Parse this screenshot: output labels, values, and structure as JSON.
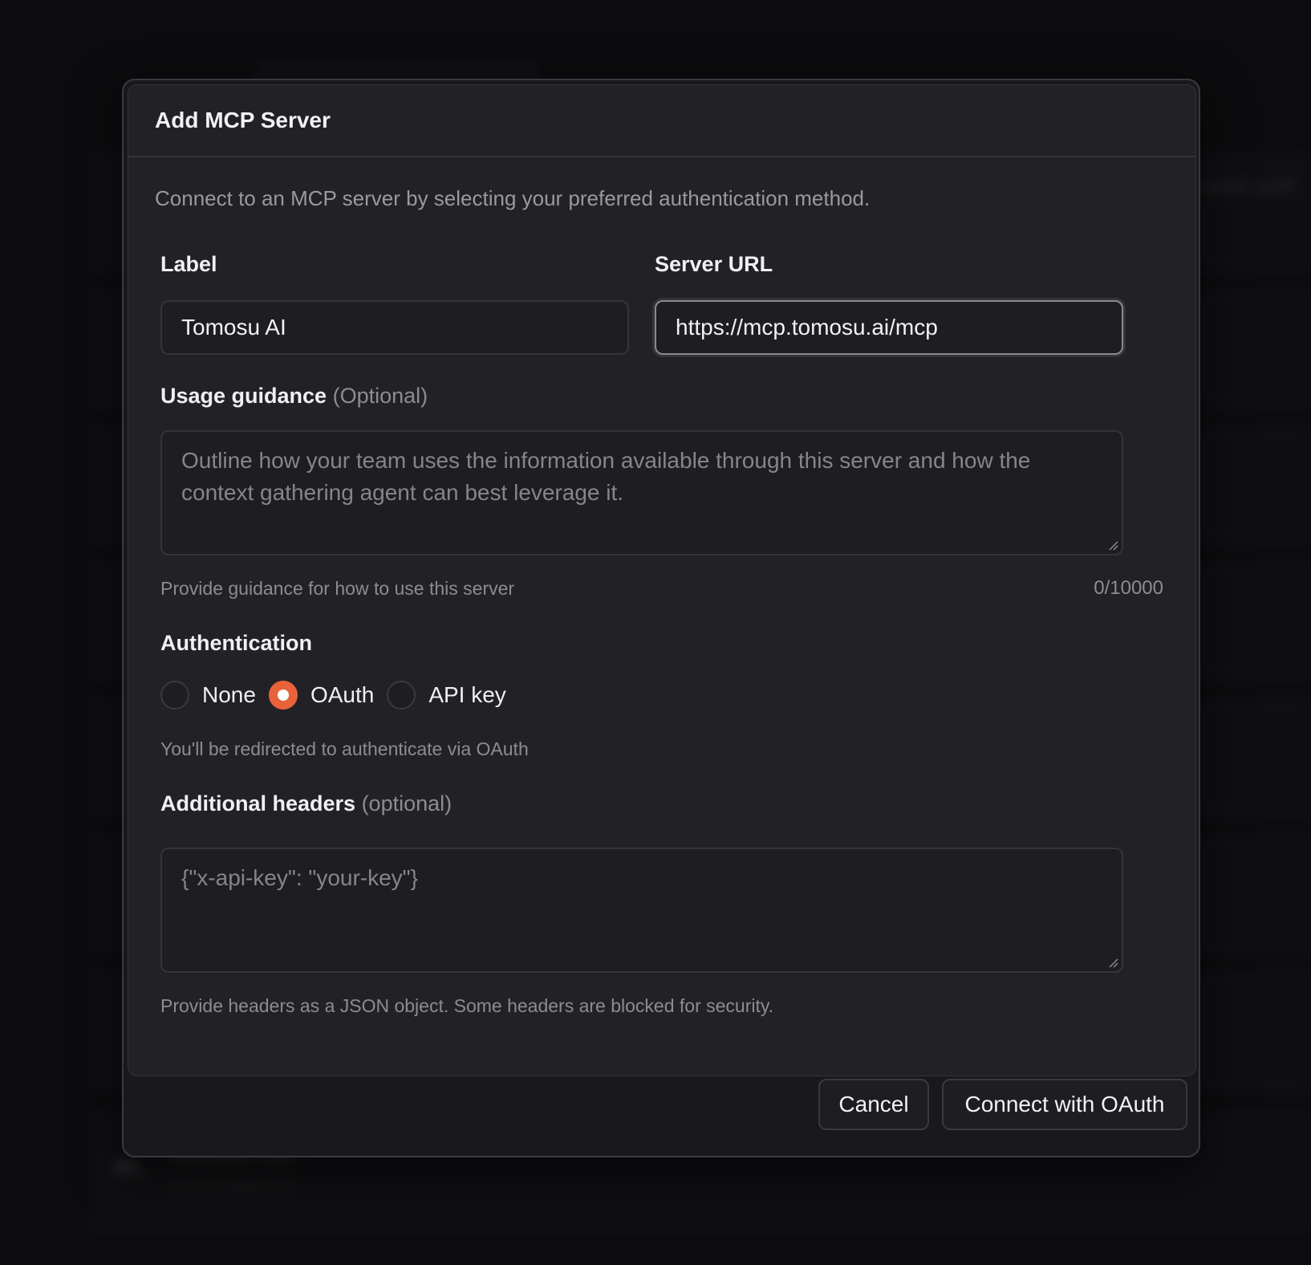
{
  "dialog": {
    "title": "Add MCP Server",
    "description": "Connect to an MCP server by selecting your preferred authentication method."
  },
  "form": {
    "label_field": {
      "label": "Label",
      "value": "Tomosu AI"
    },
    "server_url_field": {
      "label": "Server URL",
      "value": "https://mcp.tomosu.ai/mcp"
    },
    "usage_guidance": {
      "label": "Usage guidance",
      "optional": "(Optional)",
      "placeholder": "Outline how your team uses the information available through this server and how the context gathering agent can best leverage it.",
      "helper": "Provide guidance for how to use this server",
      "counter": "0/10000"
    },
    "authentication": {
      "label": "Authentication",
      "options": [
        {
          "label": "None",
          "checked": false
        },
        {
          "label": "OAuth",
          "checked": true
        },
        {
          "label": "API key",
          "checked": false
        }
      ],
      "helper": "You'll be redirected to authenticate via OAuth"
    },
    "additional_headers": {
      "label": "Additional headers",
      "optional": "(optional)",
      "placeholder": "{\"x-api-key\": \"your-key\"}",
      "helper": "Provide headers as a JSON object. Some headers are blocked for security."
    }
  },
  "footer": {
    "cancel_label": "Cancel",
    "connect_label": "Connect with OAuth"
  },
  "background": {
    "right_text": "mend conf",
    "bottom_item_name": "monday.com",
    "bottom_item_url": "mcp.monday.com",
    "bottom_item_logo": "m."
  },
  "colors": {
    "accent": "#e8633a",
    "dialog_bg": "#222126",
    "page_bg": "#0f0e12"
  }
}
